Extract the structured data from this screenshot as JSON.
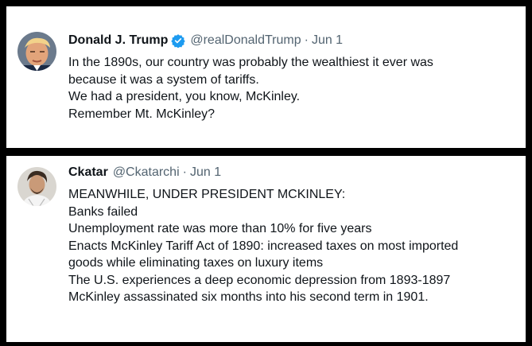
{
  "tweets": [
    {
      "display_name": "Donald J. Trump",
      "handle": "@realDonaldTrump",
      "separator": "·",
      "date": "Jun 1",
      "verified": true,
      "lines": [
        "In the 1890s, our country was probably the wealthiest it ever was",
        "because it was a system of tariffs.",
        "We had a president, you know, McKinley.",
        "Remember Mt. McKinley?"
      ]
    },
    {
      "display_name": "Ckatar",
      "handle": "@Ckatarchi",
      "separator": "·",
      "date": "Jun 1",
      "verified": false,
      "lines": [
        "MEANWHILE, UNDER PRESIDENT MCKINLEY:",
        "Banks failed",
        "Unemployment rate was more than 10% for five years",
        "Enacts McKinley Tariff Act of 1890: increased taxes on most imported",
        "goods while eliminating taxes on luxury items",
        "The U.S. experiences a deep economic depression from 1893-1897",
        "McKinley assassinated six months into his second term in 1901."
      ]
    }
  ],
  "colors": {
    "text": "#0f1419",
    "secondary": "#536471",
    "verified": "#1d9bf0",
    "background": "#000000",
    "card": "#ffffff"
  }
}
